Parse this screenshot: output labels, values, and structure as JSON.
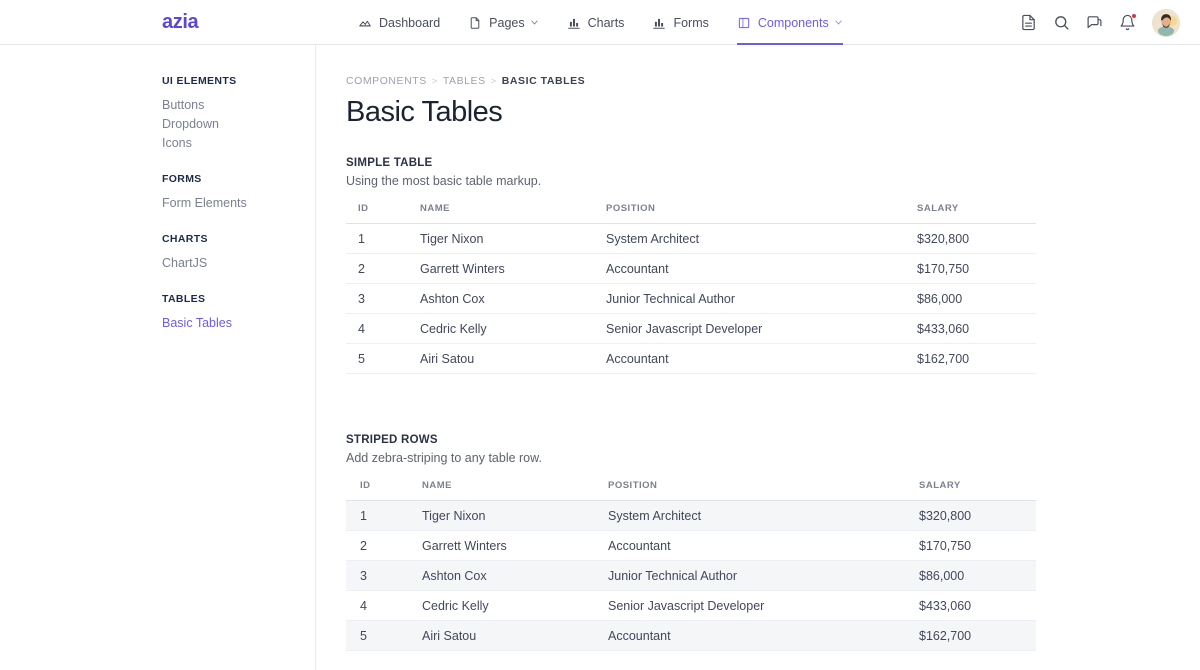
{
  "brand": {
    "logo": "azia",
    "accent": "#6e5ee0"
  },
  "nav": {
    "items": [
      {
        "label": "Dashboard",
        "icon": "dashboard-icon",
        "active": false,
        "caret": false
      },
      {
        "label": "Pages",
        "icon": "page-icon",
        "active": false,
        "caret": true
      },
      {
        "label": "Charts",
        "icon": "chart-icon",
        "active": false,
        "caret": false
      },
      {
        "label": "Forms",
        "icon": "forms-icon",
        "active": false,
        "caret": false
      },
      {
        "label": "Components",
        "icon": "components-icon",
        "active": true,
        "caret": true
      }
    ]
  },
  "header_right": {
    "icons": [
      "file-icon",
      "search-icon",
      "message-icon",
      "bell-icon"
    ],
    "avatar": "user-avatar",
    "notification": true
  },
  "sidebar": {
    "groups": [
      {
        "title": "UI ELEMENTS",
        "items": [
          {
            "label": "Buttons",
            "active": false
          },
          {
            "label": "Dropdown",
            "active": false
          },
          {
            "label": "Icons",
            "active": false
          }
        ]
      },
      {
        "title": "FORMS",
        "items": [
          {
            "label": "Form Elements",
            "active": false
          }
        ]
      },
      {
        "title": "CHARTS",
        "items": [
          {
            "label": "ChartJS",
            "active": false
          }
        ]
      },
      {
        "title": "TABLES",
        "items": [
          {
            "label": "Basic Tables",
            "active": true
          }
        ]
      }
    ]
  },
  "breadcrumb": {
    "items": [
      "COMPONENTS",
      "TABLES",
      "BASIC TABLES"
    ],
    "separator": ">"
  },
  "page": {
    "title": "Basic Tables"
  },
  "tables": [
    {
      "title": "SIMPLE TABLE",
      "description": "Using the most basic table markup.",
      "columns": [
        "ID",
        "NAME",
        "POSITION",
        "SALARY"
      ],
      "rows": [
        [
          "1",
          "Tiger Nixon",
          "System Architect",
          "$320,800"
        ],
        [
          "2",
          "Garrett Winters",
          "Accountant",
          "$170,750"
        ],
        [
          "3",
          "Ashton Cox",
          "Junior Technical Author",
          "$86,000"
        ],
        [
          "4",
          "Cedric Kelly",
          "Senior Javascript Developer",
          "$433,060"
        ],
        [
          "5",
          "Airi Satou",
          "Accountant",
          "$162,700"
        ]
      ]
    },
    {
      "title": "STRIPED ROWS",
      "description": "Add zebra-striping to any table row.",
      "columns": [
        "ID",
        "NAME",
        "POSITION",
        "SALARY"
      ],
      "rows": [
        [
          "1",
          "Tiger Nixon",
          "System Architect",
          "$320,800"
        ],
        [
          "2",
          "Garrett Winters",
          "Accountant",
          "$170,750"
        ],
        [
          "3",
          "Ashton Cox",
          "Junior Technical Author",
          "$86,000"
        ],
        [
          "4",
          "Cedric Kelly",
          "Senior Javascript Developer",
          "$433,060"
        ],
        [
          "5",
          "Airi Satou",
          "Accountant",
          "$162,700"
        ]
      ],
      "striped": true,
      "stripe_color": "#f5f6f8"
    }
  ]
}
